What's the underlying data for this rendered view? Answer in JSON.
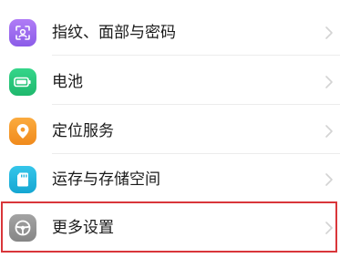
{
  "settings": {
    "items": [
      {
        "label": "指纹、面部与密码",
        "icon": "fingerprint-face-icon",
        "color": "#9a6bf0"
      },
      {
        "label": "电池",
        "icon": "battery-icon",
        "color": "#27c67a"
      },
      {
        "label": "定位服务",
        "icon": "location-pin-icon",
        "color": "#f59a2c"
      },
      {
        "label": "运存与存储空间",
        "icon": "sd-card-icon",
        "color": "#24b5dd"
      },
      {
        "label": "更多设置",
        "icon": "steering-wheel-icon",
        "color": "#8f8f8f"
      }
    ]
  },
  "highlight": {
    "color": "#d9363a",
    "target": "更多设置"
  }
}
